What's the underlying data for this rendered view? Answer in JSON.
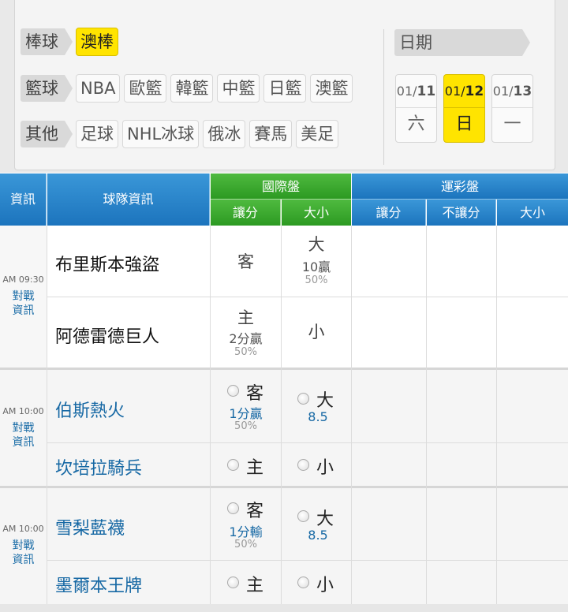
{
  "filters": {
    "baseball": {
      "label": "棒球",
      "chips": [
        "澳棒"
      ]
    },
    "basketball": {
      "label": "籃球",
      "chips": [
        "NBA",
        "歐籃",
        "韓籃",
        "中籃",
        "日籃",
        "澳籃"
      ]
    },
    "other": {
      "label": "其他",
      "chips": [
        "足球",
        "NHL冰球",
        "俄冰",
        "賽馬",
        "美足"
      ]
    }
  },
  "dates": {
    "label": "日期",
    "items": [
      {
        "month": "01/",
        "day": "11",
        "weekday": "六"
      },
      {
        "month": "01/",
        "day": "12",
        "weekday": "日"
      },
      {
        "month": "01/",
        "day": "13",
        "weekday": "一"
      }
    ]
  },
  "header": {
    "info": "資訊",
    "team": "球隊資訊",
    "intl": "國際盤",
    "lottery": "運彩盤",
    "intl_spread": "讓分",
    "intl_total": "大小",
    "lot_spread": "讓分",
    "lot_nospread": "不讓分",
    "lot_total": "大小"
  },
  "games": [
    {
      "time": "AM 09:30",
      "vs": "對戰資訊",
      "away": "布里斯本強盜",
      "home": "阿德雷德巨人",
      "away_spread": "客",
      "home_spread": "主",
      "home_spread_line": "2分贏",
      "home_spread_pct": "50%",
      "over": "大",
      "over_line": "10贏",
      "over_pct": "50%",
      "under": "小"
    },
    {
      "time": "AM 10:00",
      "vs": "對戰資訊",
      "away": "伯斯熱火",
      "home": "坎培拉騎兵",
      "away_spread": "客",
      "away_spread_line": "1分贏",
      "away_spread_pct": "50%",
      "home_spread": "主",
      "over": "大",
      "over_line": "8.5",
      "under": "小"
    },
    {
      "time": "AM 10:00",
      "vs": "對戰資訊",
      "away": "雪梨藍襪",
      "home": "墨爾本王牌",
      "away_spread": "客",
      "away_spread_line": "1分輸",
      "away_spread_pct": "50%",
      "home_spread": "主",
      "over": "大",
      "over_line": "8.5",
      "under": "小"
    }
  ],
  "colors": {
    "accent": "#ffe400",
    "header_blue": "#1c74bd",
    "header_green": "#2c9a22",
    "link": "#1668a4"
  }
}
